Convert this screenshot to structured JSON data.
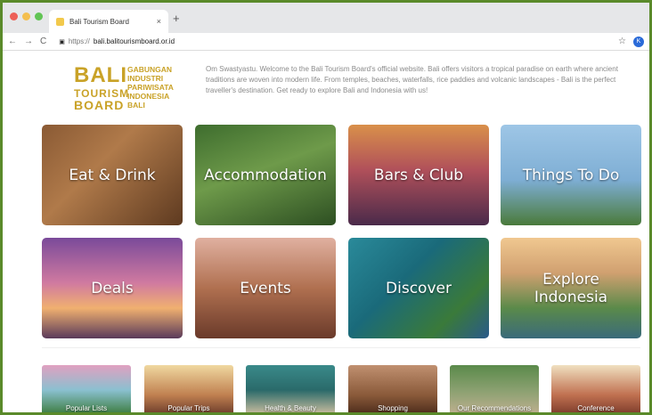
{
  "browser": {
    "tab_title": "Bali Tourism Board",
    "tab_close": "×",
    "new_tab": "+",
    "url_scheme": "https://",
    "url_host": "bali.balitourismboard.or.id",
    "back": "←",
    "forward": "→",
    "reload": "C",
    "lock": "🔒",
    "star": "☆",
    "profile_initial": "K"
  },
  "logo": {
    "bali": "BALI",
    "tourism": "TOURISM",
    "board": "BOARD",
    "line1": "GABUNGAN",
    "line2": "INDUSTRI",
    "line3": "PARIWISATA",
    "line4": "INDONESIA",
    "line5": "BALI"
  },
  "welcome": "Om Swastyastu. Welcome to the Bali Tourism Board's official website. Bali offers visitors a tropical paradise on earth where ancient traditions are woven into modern life. From temples, beaches, waterfalls, rice paddies and volcanic landscapes - Bali is the perfect traveller's destination. Get ready to explore Bali and Indonesia with us!",
  "categories": [
    {
      "label": "Eat & Drink"
    },
    {
      "label": "Accommodation"
    },
    {
      "label": "Bars & Club"
    },
    {
      "label": "Things To Do"
    },
    {
      "label": "Deals"
    },
    {
      "label": "Events"
    },
    {
      "label": "Discover"
    },
    {
      "label": "Explore Indonesia"
    }
  ],
  "strip": [
    {
      "label": "Popular Lists"
    },
    {
      "label": "Popular Trips"
    },
    {
      "label": "Health & Beauty"
    },
    {
      "label": "Shopping"
    },
    {
      "label": "Our Recommendations"
    },
    {
      "label": "Conference"
    }
  ],
  "colors": {
    "logo_gold": "#c9a227",
    "frame_green": "#5a8a2a"
  }
}
